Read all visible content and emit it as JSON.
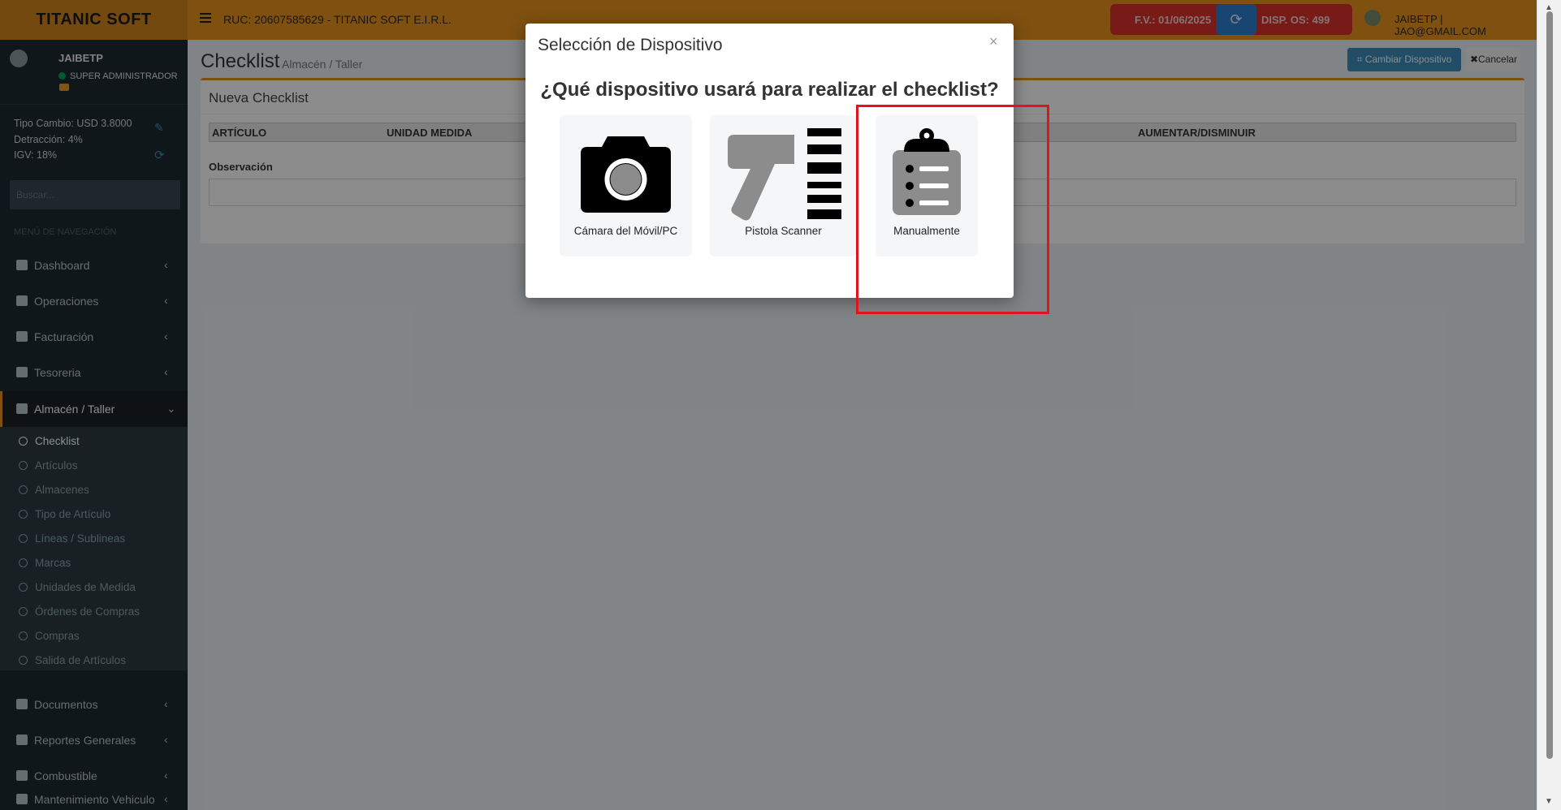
{
  "header": {
    "logo": "TITANIC SOFT",
    "ruc": "RUC: 20607585629 - TITANIC SOFT E.I.R.L.",
    "fv": "F.V.: 01/06/2025",
    "disp_os": "DISP. OS: 499",
    "refresh_icon": "⟳",
    "user": "JAIBETP | JAO@GMAIL.COM"
  },
  "sidebar": {
    "user_name": "JAIBETP",
    "user_role": "SUPER ADMINISTRADOR",
    "tipo_cambio": "Tipo Cambio: USD 3.8000",
    "detraccion": "Detracción: 4%",
    "igv": "IGV: 18%",
    "search_placeholder": "Buscar...",
    "nav_header": "MENÚ DE NAVEGACIÓN",
    "items": [
      {
        "label": "Dashboard",
        "icon": "dashboard-icon"
      },
      {
        "label": "Operaciones",
        "icon": "truck-icon"
      },
      {
        "label": "Facturación",
        "icon": "file-icon"
      },
      {
        "label": "Tesoreria",
        "icon": "money-icon"
      },
      {
        "label": "Almacén / Taller",
        "icon": "file-icon"
      },
      {
        "label": "Documentos",
        "icon": "book-icon"
      },
      {
        "label": "Reportes Generales",
        "icon": "chart-icon"
      },
      {
        "label": "Combustible",
        "icon": "chart-icon"
      },
      {
        "label": "Mantenimiento Vehiculo",
        "icon": "chart-icon"
      }
    ],
    "submenu": [
      "Checklist",
      "Artículos",
      "Almacenes",
      "Tipo de Artículo",
      "Líneas / Sublineas",
      "Marcas",
      "Unidades de Medida",
      "Órdenes de Compras",
      "Compras",
      "Salida de Artículos"
    ]
  },
  "page": {
    "title": "Checklist",
    "breadcrumb": "Almacén / Taller",
    "btn_cambiar": "Cambiar Dispositivo",
    "btn_cancelar": "✖Cancelar",
    "box_title": "Nueva Checklist",
    "columns": [
      "ARTÍCULO",
      "UNIDAD MEDIDA",
      "AUMENTAR/DISMINUIR"
    ],
    "observacion_label": "Observación"
  },
  "modal": {
    "title": "Selección de Dispositivo",
    "close": "×",
    "question": "¿Qué dispositivo usará para realizar el checklist?",
    "options": [
      {
        "label": "Cámara del Móvil/PC",
        "icon": "camera-icon"
      },
      {
        "label": "Pistola Scanner",
        "icon": "barcode-scanner-icon"
      },
      {
        "label": "Manualmente",
        "icon": "clipboard-list-icon"
      }
    ]
  },
  "colors": {
    "header": "#e8921e",
    "sidebar": "#1e2a30",
    "fv_badge": "#d9312c",
    "primary": "#3c8dbc",
    "highlight": "#e0141e"
  }
}
